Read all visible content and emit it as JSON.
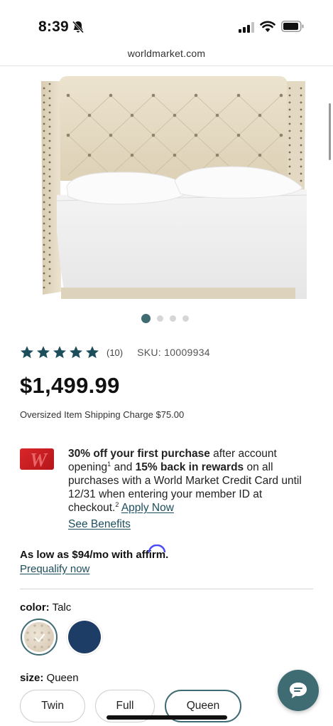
{
  "status_bar": {
    "time": "8:39"
  },
  "browser": {
    "url": "worldmarket.com"
  },
  "carousel": {
    "total_slides": 4,
    "active_index": 0
  },
  "product": {
    "rating": 5,
    "review_count": "(10)",
    "sku": "SKU: 10009934",
    "price": "$1,499.99",
    "shipping_charge": "Oversized Item Shipping Charge $75.00"
  },
  "credit_promo": {
    "offer_bold": "30% off your first purchase",
    "text_1": " after account opening",
    "sup_1": "1",
    "text_2": " and ",
    "rewards_bold": "15% back in rewards",
    "text_3": " on all purchases with a World Market Credit Card until 12/31 when entering your member ID at checkout.",
    "sup_2": "2",
    "apply_link": "Apply Now",
    "benefits_link": "See Benefits"
  },
  "affirm": {
    "text": "As low as $94/mo with ",
    "logo_text": "affirm",
    "period": ".",
    "prequalify_link": "Prequalify now"
  },
  "color": {
    "label": "color:",
    "selected": "Talc",
    "options": [
      "Talc",
      "Navy"
    ]
  },
  "size": {
    "label": "size:",
    "selected": "Queen",
    "options": [
      "Twin",
      "Full",
      "Queen"
    ]
  },
  "colors": {
    "accent": "#3f6b73",
    "link": "#1d4e5c",
    "card_red": "#d9262a",
    "navy_swatch": "#1e3d66"
  }
}
